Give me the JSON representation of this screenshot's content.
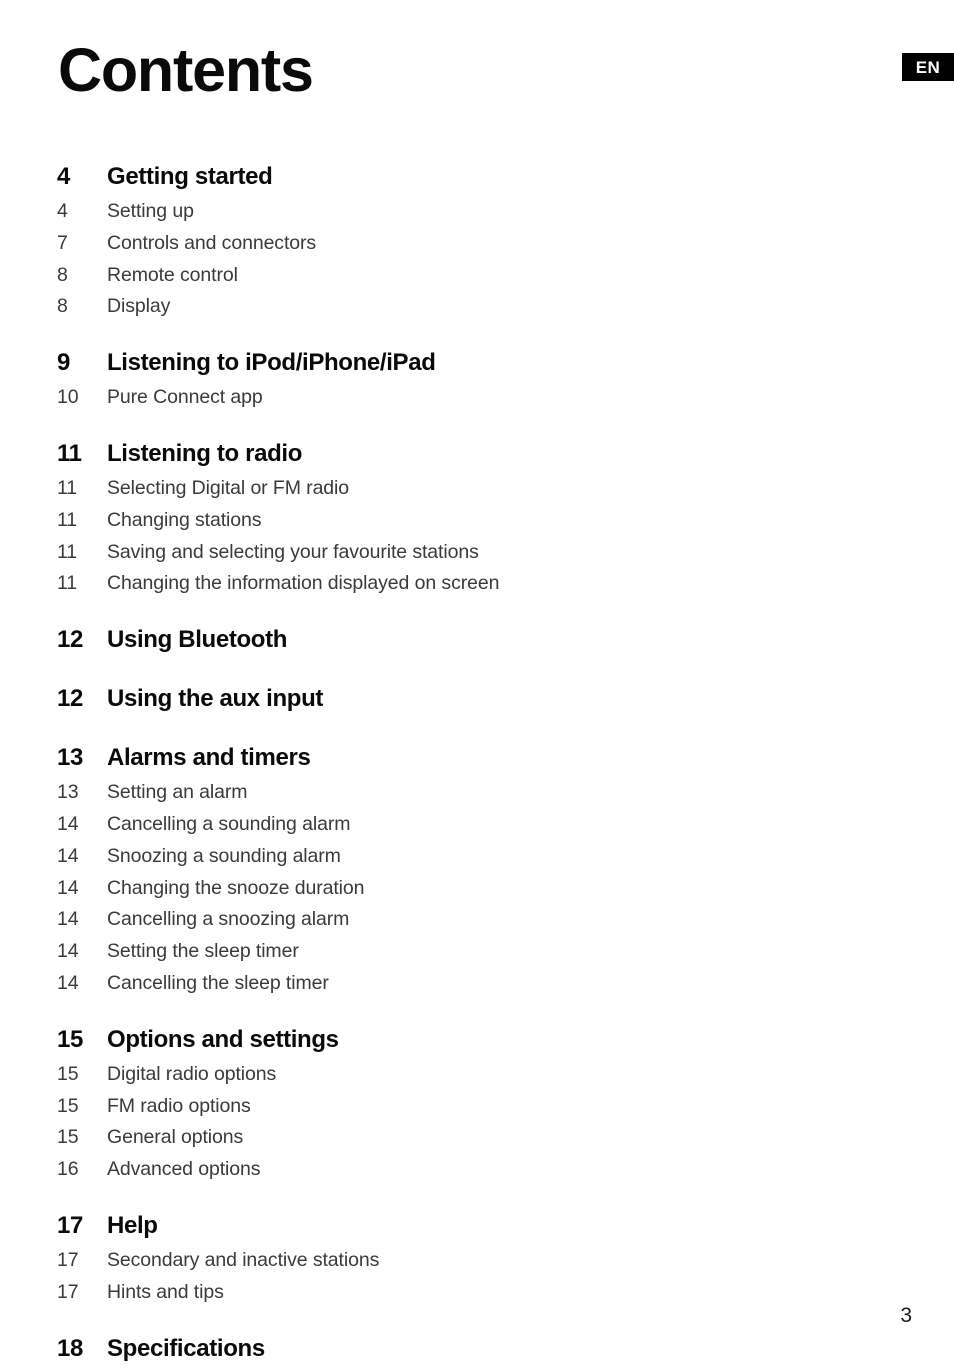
{
  "document": {
    "title": "Contents",
    "language_badge": "EN",
    "folio": "3"
  },
  "toc": {
    "sections": [
      {
        "page": "4",
        "title": "Getting started",
        "items": [
          {
            "page": "4",
            "label": "Setting up"
          },
          {
            "page": "7",
            "label": "Controls and connectors"
          },
          {
            "page": "8",
            "label": "Remote control"
          },
          {
            "page": "8",
            "label": "Display"
          }
        ]
      },
      {
        "page": "9",
        "title": "Listening to iPod/iPhone/iPad",
        "items": [
          {
            "page": "10",
            "label": "Pure Connect app"
          }
        ]
      },
      {
        "page": "11",
        "title": "Listening to radio",
        "items": [
          {
            "page": "11",
            "label": "Selecting Digital or FM radio"
          },
          {
            "page": "11",
            "label": "Changing stations"
          },
          {
            "page": "11",
            "label": "Saving and selecting your favourite stations"
          },
          {
            "page": "11",
            "label": "Changing the information displayed on screen"
          }
        ]
      },
      {
        "page": "12",
        "title": "Using Bluetooth",
        "items": []
      },
      {
        "page": "12",
        "title": "Using the aux input",
        "items": []
      },
      {
        "page": "13",
        "title": "Alarms and timers",
        "items": [
          {
            "page": "13",
            "label": "Setting an alarm"
          },
          {
            "page": "14",
            "label": "Cancelling a sounding alarm"
          },
          {
            "page": "14",
            "label": "Snoozing a sounding alarm"
          },
          {
            "page": "14",
            "label": "Changing the snooze duration"
          },
          {
            "page": "14",
            "label": "Cancelling a snoozing alarm"
          },
          {
            "page": "14",
            "label": "Setting the sleep timer"
          },
          {
            "page": "14",
            "label": "Cancelling the sleep timer"
          }
        ]
      },
      {
        "page": "15",
        "title": "Options and settings",
        "items": [
          {
            "page": "15",
            "label": "Digital radio options"
          },
          {
            "page": "15",
            "label": "FM radio options"
          },
          {
            "page": "15",
            "label": "General options"
          },
          {
            "page": "16",
            "label": "Advanced options"
          }
        ]
      },
      {
        "page": "17",
        "title": "Help",
        "items": [
          {
            "page": "17",
            "label": "Secondary and inactive stations"
          },
          {
            "page": "17",
            "label": "Hints and tips"
          }
        ]
      },
      {
        "page": "18",
        "title": "Specifications",
        "items": []
      }
    ]
  },
  "colors": {
    "heading": "#0a0a0a",
    "body": "#3a3a3a",
    "badge_background": "#000000",
    "badge_text": "#ffffff",
    "page_background": "#ffffff"
  }
}
